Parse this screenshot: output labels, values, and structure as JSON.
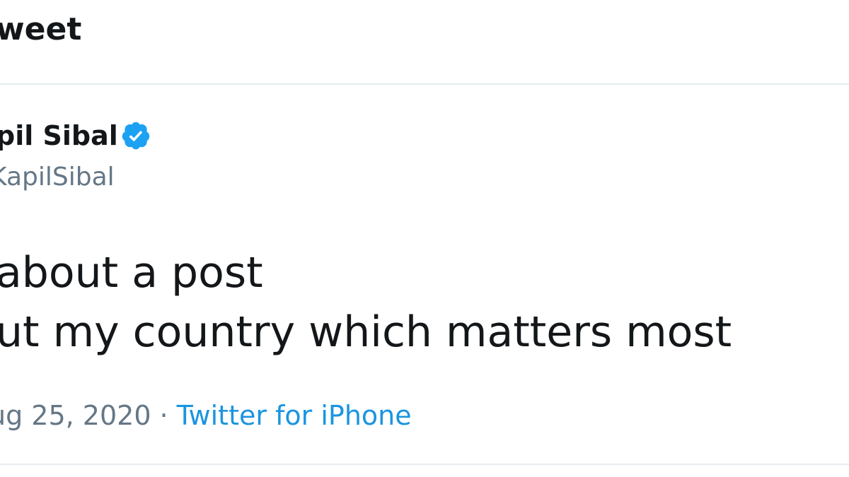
{
  "header": {
    "title": "weet"
  },
  "tweet": {
    "author_name": "pil Sibal",
    "verified_icon": "verified-badge-icon",
    "handle": "KapilSibal",
    "lines": [
      "about a post",
      "ut my country which matters most"
    ],
    "date": "ug 25, 2020",
    "separator": "·",
    "source": "Twitter for iPhone"
  },
  "colors": {
    "text": "#14171a",
    "secondary": "#657786",
    "link": "#1b95e0",
    "verified": "#1da1f2",
    "divider": "#e6ecf0"
  }
}
